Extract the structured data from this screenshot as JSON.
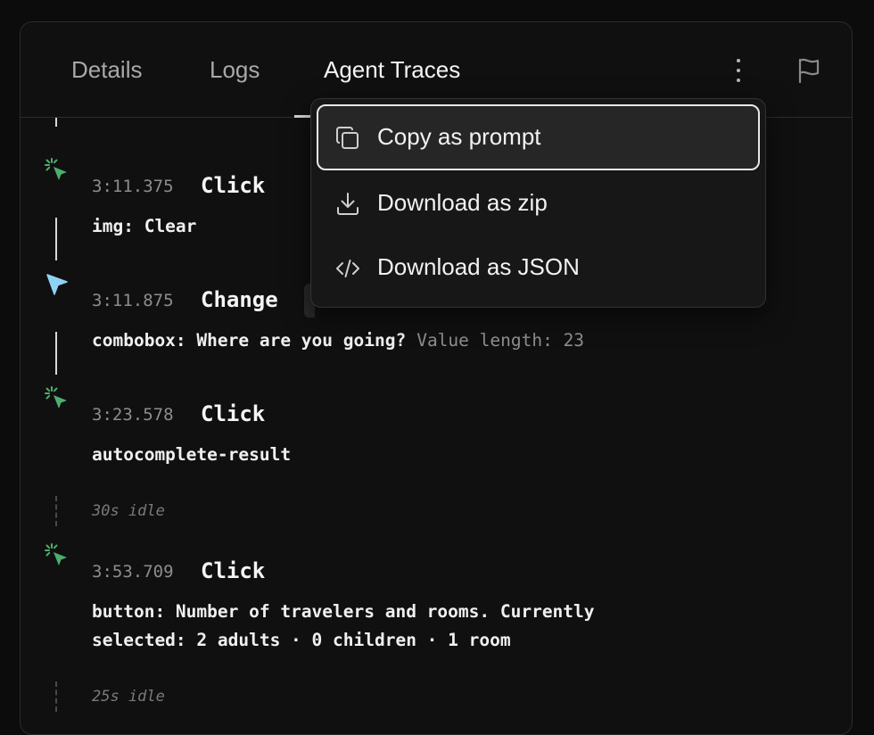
{
  "tabs": [
    {
      "label": "Details",
      "active": false
    },
    {
      "label": "Logs",
      "active": false
    },
    {
      "label": "Agent Traces",
      "active": true
    }
  ],
  "header_icons": {
    "more": "kebab-vertical-icon",
    "flag": "flag-icon"
  },
  "colors": {
    "click_icon": "#4caf6e",
    "change_icon": "#8fd3f4",
    "accent_border": "#e9e9e9"
  },
  "events": [
    {
      "time": "3:11.375",
      "action": "Click",
      "icon": "click-cursor-icon",
      "detail": "img: Clear"
    },
    {
      "time": "3:11.875",
      "action": "Change",
      "icon": "pointer-arrow-icon",
      "detail": "combobox: Where are you going?",
      "detail_extra": "Value length: 23"
    },
    {
      "time": "3:23.578",
      "action": "Click",
      "icon": "click-cursor-icon",
      "detail": "autocomplete-result"
    },
    {
      "idle": "30s idle"
    },
    {
      "time": "3:53.709",
      "action": "Click",
      "icon": "click-cursor-icon",
      "detail_line1": "button: Number of travelers and rooms. Currently",
      "detail_line2": "selected: 2 adults · 0 children · 1 room"
    },
    {
      "idle": "25s idle"
    }
  ],
  "menu": {
    "items": [
      {
        "label": "Copy as prompt",
        "icon": "copy-icon",
        "selected": true
      },
      {
        "label": "Download as zip",
        "icon": "download-icon",
        "selected": false
      },
      {
        "label": "Download as JSON",
        "icon": "code-icon",
        "selected": false
      }
    ]
  }
}
